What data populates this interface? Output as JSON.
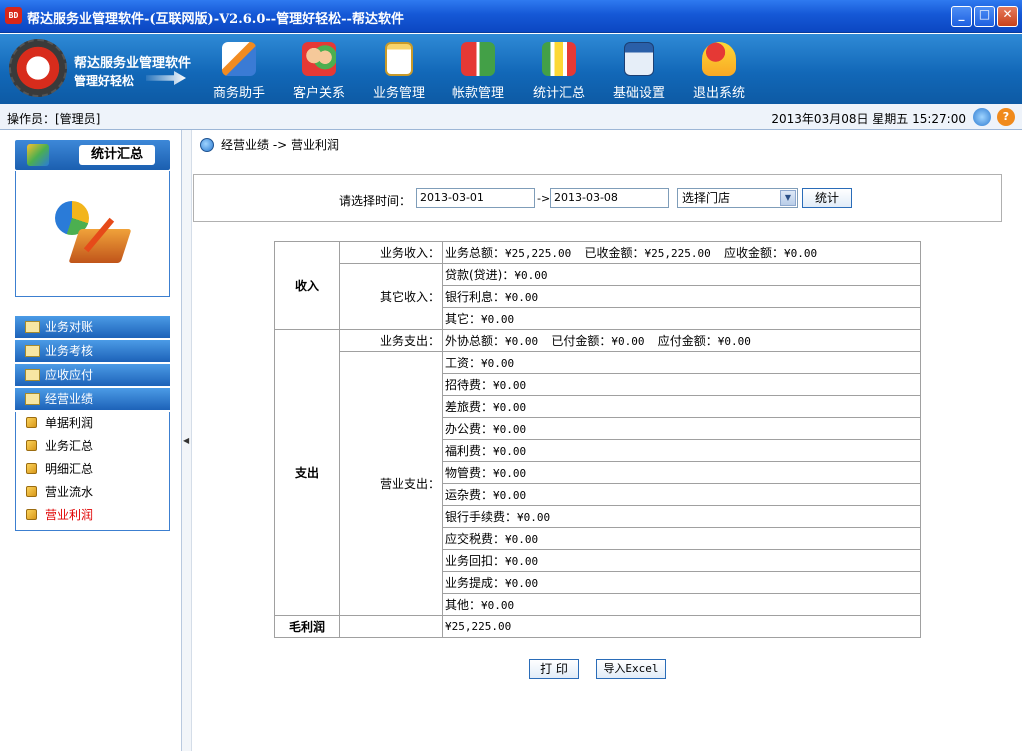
{
  "window": {
    "title": "帮达服务业管理软件-(互联网版)-V2.6.0--管理好轻松--帮达软件",
    "app_icon_text": "BD",
    "minimize": "_",
    "maximize": "□",
    "close": "✕"
  },
  "banner": {
    "brand_name": "帮达服务业管理软件",
    "slogan": "管理好轻松",
    "nav": [
      {
        "label": "商务助手",
        "icon": "pencil-paper-icon"
      },
      {
        "label": "客户关系",
        "icon": "people-icon"
      },
      {
        "label": "业务管理",
        "icon": "clipboard-icon"
      },
      {
        "label": "帐款管理",
        "icon": "transfer-icon"
      },
      {
        "label": "统计汇总",
        "icon": "chart-icon"
      },
      {
        "label": "基础设置",
        "icon": "calculator-icon"
      },
      {
        "label": "退出系统",
        "icon": "exit-icon"
      }
    ]
  },
  "status": {
    "operator": "操作员：[管理员]",
    "datetime": "2013年03月08日  星期五  15:27:00"
  },
  "sidebar": {
    "header": "统计汇总",
    "groups": [
      "业务对账",
      "业务考核",
      "应收应付",
      "经营业绩"
    ],
    "items": [
      {
        "label": "单据利润"
      },
      {
        "label": "业务汇总"
      },
      {
        "label": "明细汇总"
      },
      {
        "label": "营业流水"
      },
      {
        "label": "营业利润"
      }
    ]
  },
  "breadcrumb": "经营业绩  ->  营业利润",
  "filter": {
    "label": "请选择时间：",
    "start_date": "2013-03-01",
    "separator": "->",
    "end_date": "2013-03-08",
    "store_select": "选择门店",
    "stat_button": "统计"
  },
  "report": {
    "income_label": "收入",
    "biz_income_label": "业务收入：",
    "biz_income_total_label": "业务总额：",
    "biz_income_total": "¥25,225.00",
    "biz_income_received_label": "已收金额：",
    "biz_income_received": "¥25,225.00",
    "biz_income_receivable_label": "应收金额：",
    "biz_income_receivable": "¥0.00",
    "other_income_label": "其它收入：",
    "other_income": [
      {
        "label": "贷款(贷进)：",
        "value": "¥0.00"
      },
      {
        "label": "银行利息：",
        "value": "¥0.00"
      },
      {
        "label": "其它：",
        "value": "¥0.00"
      }
    ],
    "expense_label": "支出",
    "biz_expense_label": "业务支出：",
    "biz_expense_total_label": "外协总额：",
    "biz_expense_total": "¥0.00",
    "biz_expense_paid_label": "已付金额：",
    "biz_expense_paid": "¥0.00",
    "biz_expense_payable_label": "应付金额：",
    "biz_expense_payable": "¥0.00",
    "op_expense_label": "营业支出：",
    "op_expense": [
      {
        "label": "工资：",
        "value": "¥0.00"
      },
      {
        "label": "招待费：",
        "value": "¥0.00"
      },
      {
        "label": "差旅费：",
        "value": "¥0.00"
      },
      {
        "label": "办公费：",
        "value": "¥0.00"
      },
      {
        "label": "福利费：",
        "value": "¥0.00"
      },
      {
        "label": "物管费：",
        "value": "¥0.00"
      },
      {
        "label": "运杂费：",
        "value": "¥0.00"
      },
      {
        "label": "银行手续费：",
        "value": "¥0.00"
      },
      {
        "label": "应交税费：",
        "value": "¥0.00"
      },
      {
        "label": "业务回扣：",
        "value": "¥0.00"
      },
      {
        "label": "业务提成：",
        "value": "¥0.00"
      },
      {
        "label": "其他：",
        "value": "¥0.00"
      }
    ],
    "gross_profit_label": "毛利润",
    "gross_profit": "¥25,225.00"
  },
  "actions": {
    "print": "打 印",
    "export": "导入Excel"
  },
  "colors": {
    "titlebar": "#1558d6",
    "banner": "#1268b8",
    "active_item": "#e00000"
  }
}
